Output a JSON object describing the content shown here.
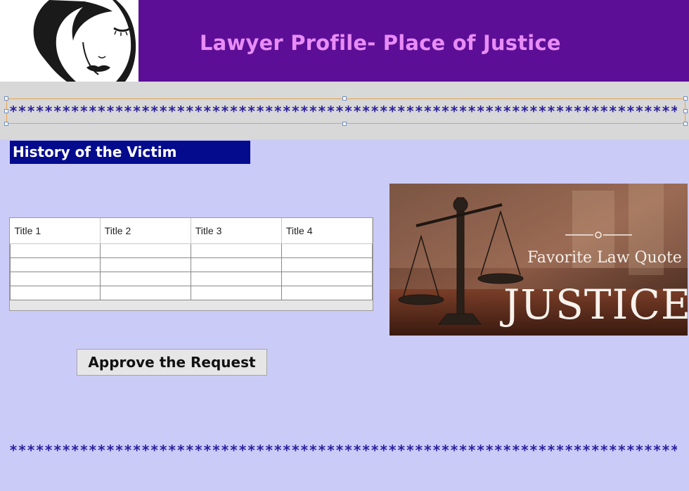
{
  "header": {
    "title": "Lawyer Profile- Place of Justice"
  },
  "stars": {
    "top": "**************************************************************************************",
    "bottom": "**************************************************************************************"
  },
  "section": {
    "heading": "History of the Victim"
  },
  "grid": {
    "columns": [
      "Title 1",
      "Title 2",
      "Title 3",
      "Title 4"
    ],
    "rows": [
      [
        "",
        "",
        "",
        ""
      ],
      [
        "",
        "",
        "",
        ""
      ],
      [
        "",
        "",
        "",
        ""
      ],
      [
        "",
        "",
        "",
        ""
      ]
    ]
  },
  "justice_image": {
    "quote_label": "Favorite Law Quote",
    "word": "JUSTICE"
  },
  "actions": {
    "approve_label": "Approve the Request"
  },
  "colors": {
    "header_bg": "#5c0f96",
    "title_color": "#e98cf6",
    "page_bg": "#cbcbf7",
    "section_bg": "#050b8d",
    "stars_color": "#2b1f9e"
  }
}
